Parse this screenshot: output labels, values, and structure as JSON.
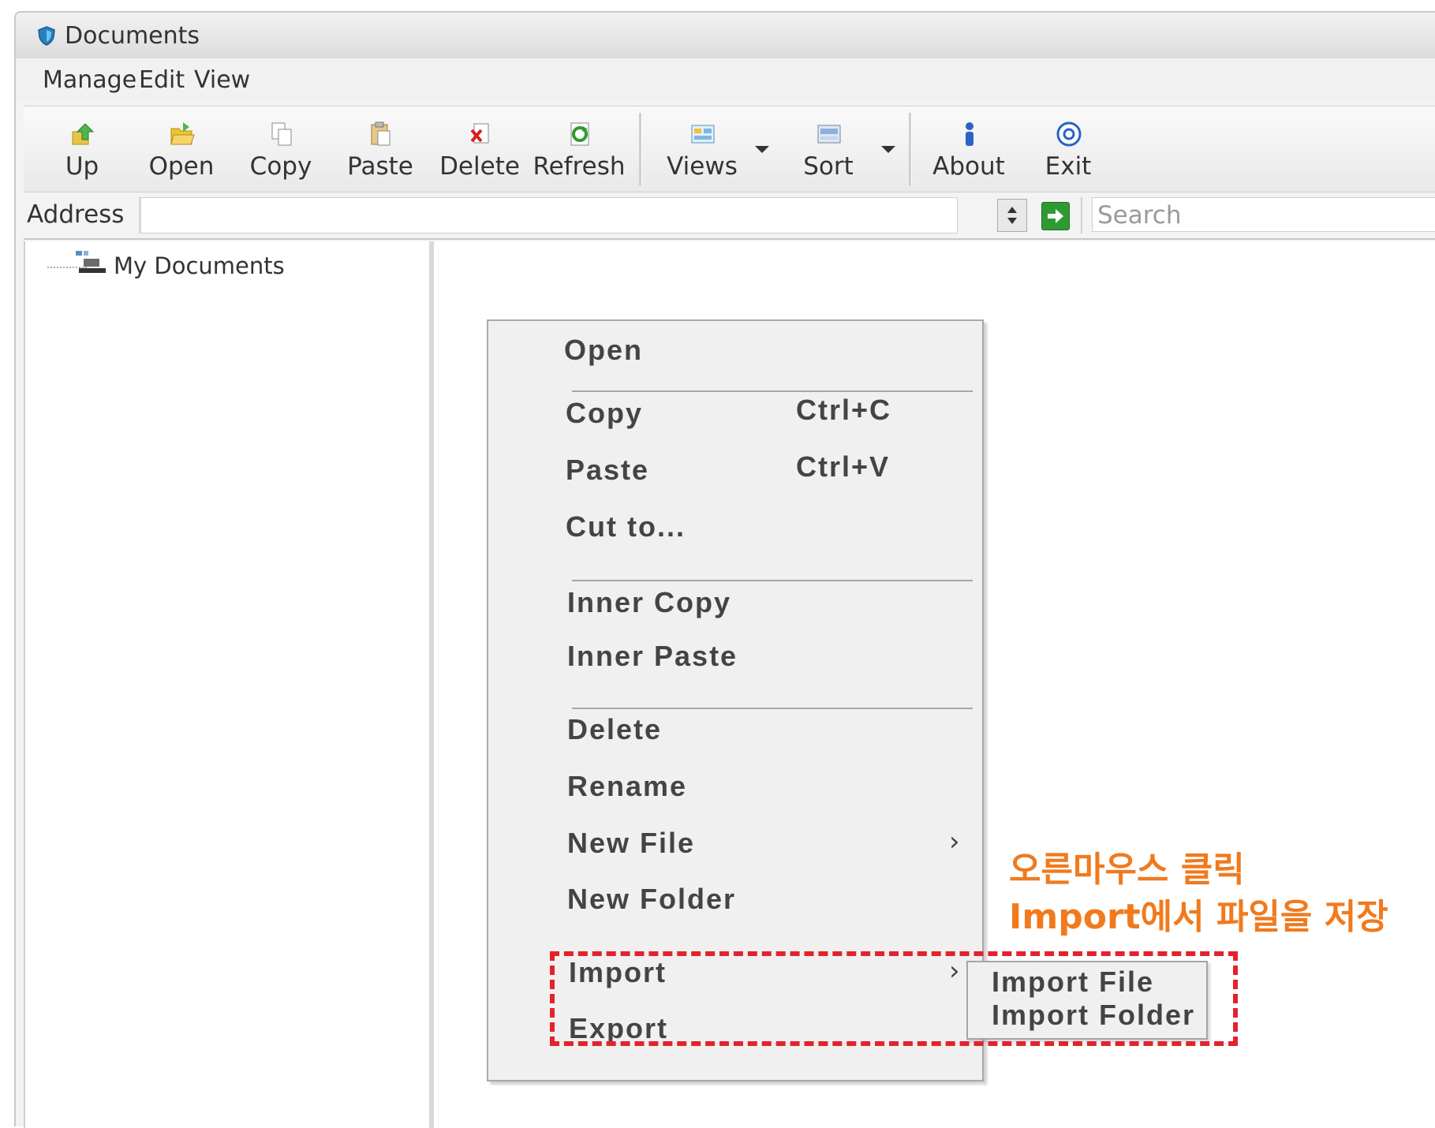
{
  "window": {
    "title": "Documents"
  },
  "menubar": {
    "items": [
      "Manage",
      "Edit",
      "View"
    ]
  },
  "toolbar": {
    "buttons": [
      {
        "label": "Up",
        "icon": "up-arrow-icon"
      },
      {
        "label": "Open",
        "icon": "open-folder-icon"
      },
      {
        "label": "Copy",
        "icon": "copy-icon"
      },
      {
        "label": "Paste",
        "icon": "paste-icon"
      },
      {
        "label": "Delete",
        "icon": "delete-icon"
      },
      {
        "label": "Refresh",
        "icon": "refresh-icon"
      },
      {
        "label": "Views",
        "icon": "views-icon"
      },
      {
        "label": "Sort",
        "icon": "sort-icon"
      },
      {
        "label": "About",
        "icon": "about-icon"
      },
      {
        "label": "Exit",
        "icon": "exit-icon"
      }
    ]
  },
  "address": {
    "label": "Address",
    "value": "",
    "search_placeholder": "Search"
  },
  "tree": {
    "root": "My Documents"
  },
  "context_menu": {
    "open": "Open",
    "copy": "Copy",
    "copy_shortcut": "Ctrl+C",
    "paste": "Paste",
    "paste_shortcut": "Ctrl+V",
    "cut_to": "Cut to...",
    "inner_copy": "Inner Copy",
    "inner_paste": "Inner Paste",
    "delete": "Delete",
    "rename": "Rename",
    "new_file": "New File",
    "new_folder": "New Folder",
    "import": "Import",
    "export": "Export",
    "submenu_arrow": "›"
  },
  "import_submenu": {
    "import_file": "Import File",
    "import_folder": "Import Folder"
  },
  "annotation": {
    "line1": "오른마우스 클릭",
    "line2": "Import에서 파일을 저장",
    "text_color": "#f07a1d",
    "box_color": "#e3222b"
  }
}
